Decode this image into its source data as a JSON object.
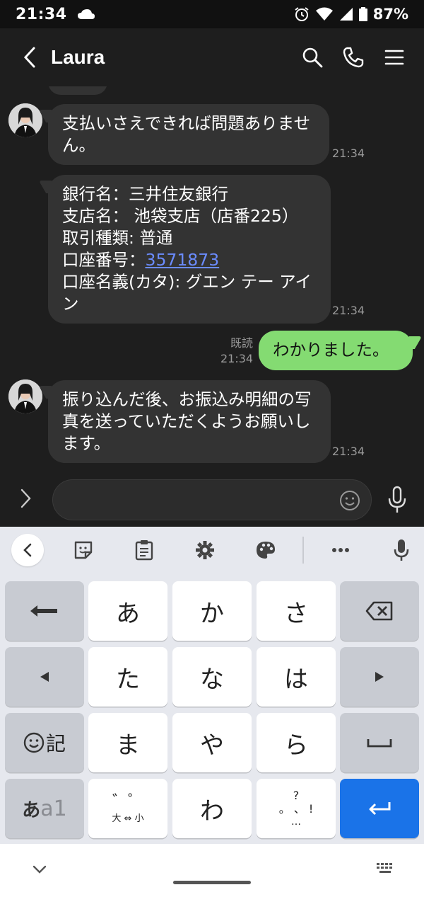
{
  "status_bar": {
    "time": "21:34",
    "battery": "87%"
  },
  "header": {
    "title": "Laura"
  },
  "messages": [
    {
      "id": 1,
      "sender": "Laura",
      "direction": "in",
      "text": "支払いさえできれば問題ありません。",
      "time": "21:34"
    },
    {
      "id": 2,
      "sender": "Laura",
      "direction": "in",
      "lines": {
        "bank": "銀行名：三井住友銀行",
        "branch": "支店名： 池袋支店（店番225）",
        "type": "取引種類: 普通",
        "account_label": "口座番号：",
        "account_number": "3571873",
        "holder": "口座名義(カタ): グエン テー アイン"
      },
      "time": "21:34"
    },
    {
      "id": 3,
      "sender": "me",
      "direction": "out",
      "text": "わかりました。",
      "read": "既読",
      "time": "21:34"
    },
    {
      "id": 4,
      "sender": "Laura",
      "direction": "in",
      "text": "振り込んだ後、お振込み明細の写真を送っていただくようお願いします。",
      "time": "21:34"
    }
  ],
  "input": {
    "placeholder": ""
  },
  "keyboard": {
    "rows": [
      [
        "←",
        "あ",
        "か",
        "さ",
        "⌫"
      ],
      [
        "◀",
        "た",
        "な",
        "は",
        "▶"
      ],
      [
        "☺記",
        "ま",
        "や",
        "ら",
        "␣"
      ],
      [
        "あa1",
        "゛゜大⇔小",
        "わ",
        "、。?!",
        "↵"
      ]
    ],
    "kana": {
      "a": "あ",
      "ka": "か",
      "sa": "さ",
      "ta": "た",
      "na": "な",
      "ha": "は",
      "ma": "ま",
      "ya": "や",
      "ra": "ら",
      "wa": "わ"
    },
    "emoji_key_label": "記",
    "mode_key_label": "あ",
    "mode_key_label2": "a1",
    "dakuten_label": "゛゜",
    "size_toggle_label": "大 ⇔ 小",
    "punct_q": "?",
    "punct_main": "。 、",
    "punct_excl": "!",
    "punct_ellipsis": "…"
  },
  "colors": {
    "accent_green": "#84db72",
    "enter_blue": "#1a73e8",
    "link_blue": "#6b8cff"
  }
}
